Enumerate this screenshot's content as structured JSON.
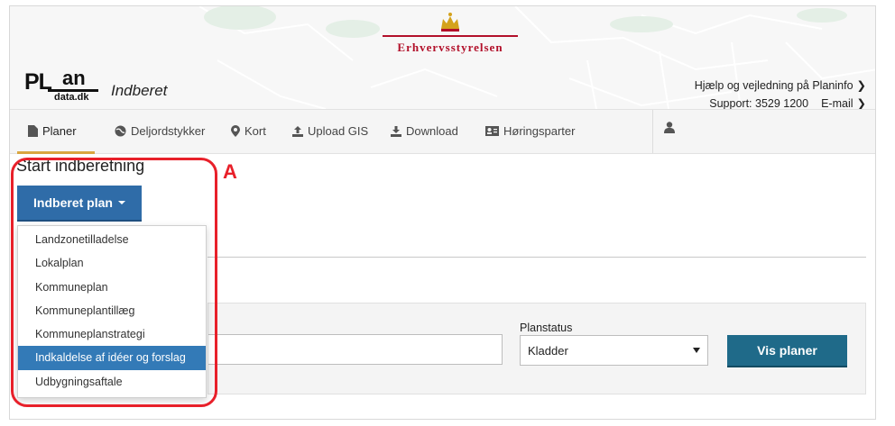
{
  "header": {
    "logo_main": "PL",
    "logo_an": "an",
    "logo_sub": "data.dk",
    "app_title": "Indberet",
    "brand": "Erhvervsstyrelsen",
    "help_link": "Hjælp og vejledning på Planinfo",
    "support_text": "Support: 3529 1200",
    "email_link": "E-mail"
  },
  "nav": {
    "items": [
      {
        "label": "Planer",
        "icon": "document-icon"
      },
      {
        "label": "Deljordstykker",
        "icon": "globe-icon"
      },
      {
        "label": "Kort",
        "icon": "map-marker-icon"
      },
      {
        "label": "Upload GIS",
        "icon": "upload-icon"
      },
      {
        "label": "Download",
        "icon": "download-icon"
      },
      {
        "label": "Høringsparter",
        "icon": "contact-card-icon"
      }
    ],
    "user_icon": "user-icon",
    "active_color": "#d9a640"
  },
  "main": {
    "title": "Start indberetning",
    "dropdown_button": "Indberet plan",
    "dropdown_items": [
      "Landzonetilladelse",
      "Lokalplan",
      "Kommuneplan",
      "Kommuneplantillæg",
      "Kommuneplanstrategi",
      "Indkaldelse af idéer og forslag",
      "Udbygningsaftale"
    ],
    "selected_item": "Indkaldelse af idéer og forslag",
    "planstatus_label": "Planstatus",
    "planstatus_value": "Kladder",
    "search_button": "Vis planer"
  },
  "annotation": {
    "label": "A",
    "color": "#e8202a"
  },
  "colors": {
    "primary_button": "#2f6ca8",
    "search_button": "#1f6a89",
    "brand_red": "#b2102a",
    "selected_item": "#337ab7"
  }
}
